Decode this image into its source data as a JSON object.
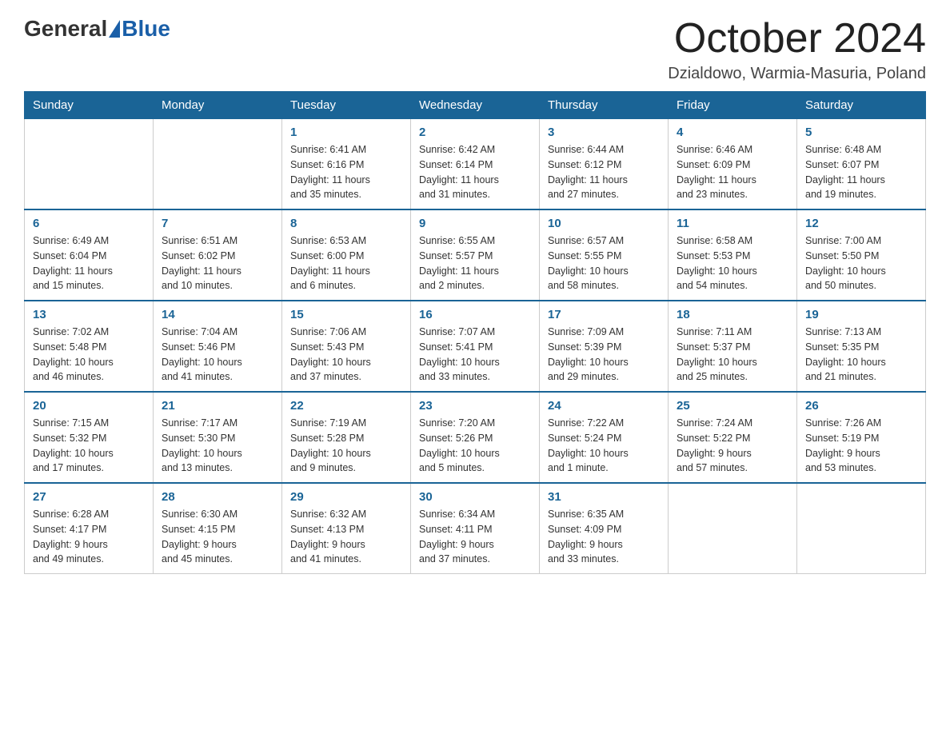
{
  "header": {
    "logo_general": "General",
    "logo_blue": "Blue",
    "month_title": "October 2024",
    "location": "Dzialdowo, Warmia-Masuria, Poland"
  },
  "weekdays": [
    "Sunday",
    "Monday",
    "Tuesday",
    "Wednesday",
    "Thursday",
    "Friday",
    "Saturday"
  ],
  "weeks": [
    [
      {
        "day": "",
        "info": ""
      },
      {
        "day": "",
        "info": ""
      },
      {
        "day": "1",
        "info": "Sunrise: 6:41 AM\nSunset: 6:16 PM\nDaylight: 11 hours\nand 35 minutes."
      },
      {
        "day": "2",
        "info": "Sunrise: 6:42 AM\nSunset: 6:14 PM\nDaylight: 11 hours\nand 31 minutes."
      },
      {
        "day": "3",
        "info": "Sunrise: 6:44 AM\nSunset: 6:12 PM\nDaylight: 11 hours\nand 27 minutes."
      },
      {
        "day": "4",
        "info": "Sunrise: 6:46 AM\nSunset: 6:09 PM\nDaylight: 11 hours\nand 23 minutes."
      },
      {
        "day": "5",
        "info": "Sunrise: 6:48 AM\nSunset: 6:07 PM\nDaylight: 11 hours\nand 19 minutes."
      }
    ],
    [
      {
        "day": "6",
        "info": "Sunrise: 6:49 AM\nSunset: 6:04 PM\nDaylight: 11 hours\nand 15 minutes."
      },
      {
        "day": "7",
        "info": "Sunrise: 6:51 AM\nSunset: 6:02 PM\nDaylight: 11 hours\nand 10 minutes."
      },
      {
        "day": "8",
        "info": "Sunrise: 6:53 AM\nSunset: 6:00 PM\nDaylight: 11 hours\nand 6 minutes."
      },
      {
        "day": "9",
        "info": "Sunrise: 6:55 AM\nSunset: 5:57 PM\nDaylight: 11 hours\nand 2 minutes."
      },
      {
        "day": "10",
        "info": "Sunrise: 6:57 AM\nSunset: 5:55 PM\nDaylight: 10 hours\nand 58 minutes."
      },
      {
        "day": "11",
        "info": "Sunrise: 6:58 AM\nSunset: 5:53 PM\nDaylight: 10 hours\nand 54 minutes."
      },
      {
        "day": "12",
        "info": "Sunrise: 7:00 AM\nSunset: 5:50 PM\nDaylight: 10 hours\nand 50 minutes."
      }
    ],
    [
      {
        "day": "13",
        "info": "Sunrise: 7:02 AM\nSunset: 5:48 PM\nDaylight: 10 hours\nand 46 minutes."
      },
      {
        "day": "14",
        "info": "Sunrise: 7:04 AM\nSunset: 5:46 PM\nDaylight: 10 hours\nand 41 minutes."
      },
      {
        "day": "15",
        "info": "Sunrise: 7:06 AM\nSunset: 5:43 PM\nDaylight: 10 hours\nand 37 minutes."
      },
      {
        "day": "16",
        "info": "Sunrise: 7:07 AM\nSunset: 5:41 PM\nDaylight: 10 hours\nand 33 minutes."
      },
      {
        "day": "17",
        "info": "Sunrise: 7:09 AM\nSunset: 5:39 PM\nDaylight: 10 hours\nand 29 minutes."
      },
      {
        "day": "18",
        "info": "Sunrise: 7:11 AM\nSunset: 5:37 PM\nDaylight: 10 hours\nand 25 minutes."
      },
      {
        "day": "19",
        "info": "Sunrise: 7:13 AM\nSunset: 5:35 PM\nDaylight: 10 hours\nand 21 minutes."
      }
    ],
    [
      {
        "day": "20",
        "info": "Sunrise: 7:15 AM\nSunset: 5:32 PM\nDaylight: 10 hours\nand 17 minutes."
      },
      {
        "day": "21",
        "info": "Sunrise: 7:17 AM\nSunset: 5:30 PM\nDaylight: 10 hours\nand 13 minutes."
      },
      {
        "day": "22",
        "info": "Sunrise: 7:19 AM\nSunset: 5:28 PM\nDaylight: 10 hours\nand 9 minutes."
      },
      {
        "day": "23",
        "info": "Sunrise: 7:20 AM\nSunset: 5:26 PM\nDaylight: 10 hours\nand 5 minutes."
      },
      {
        "day": "24",
        "info": "Sunrise: 7:22 AM\nSunset: 5:24 PM\nDaylight: 10 hours\nand 1 minute."
      },
      {
        "day": "25",
        "info": "Sunrise: 7:24 AM\nSunset: 5:22 PM\nDaylight: 9 hours\nand 57 minutes."
      },
      {
        "day": "26",
        "info": "Sunrise: 7:26 AM\nSunset: 5:19 PM\nDaylight: 9 hours\nand 53 minutes."
      }
    ],
    [
      {
        "day": "27",
        "info": "Sunrise: 6:28 AM\nSunset: 4:17 PM\nDaylight: 9 hours\nand 49 minutes."
      },
      {
        "day": "28",
        "info": "Sunrise: 6:30 AM\nSunset: 4:15 PM\nDaylight: 9 hours\nand 45 minutes."
      },
      {
        "day": "29",
        "info": "Sunrise: 6:32 AM\nSunset: 4:13 PM\nDaylight: 9 hours\nand 41 minutes."
      },
      {
        "day": "30",
        "info": "Sunrise: 6:34 AM\nSunset: 4:11 PM\nDaylight: 9 hours\nand 37 minutes."
      },
      {
        "day": "31",
        "info": "Sunrise: 6:35 AM\nSunset: 4:09 PM\nDaylight: 9 hours\nand 33 minutes."
      },
      {
        "day": "",
        "info": ""
      },
      {
        "day": "",
        "info": ""
      }
    ]
  ]
}
